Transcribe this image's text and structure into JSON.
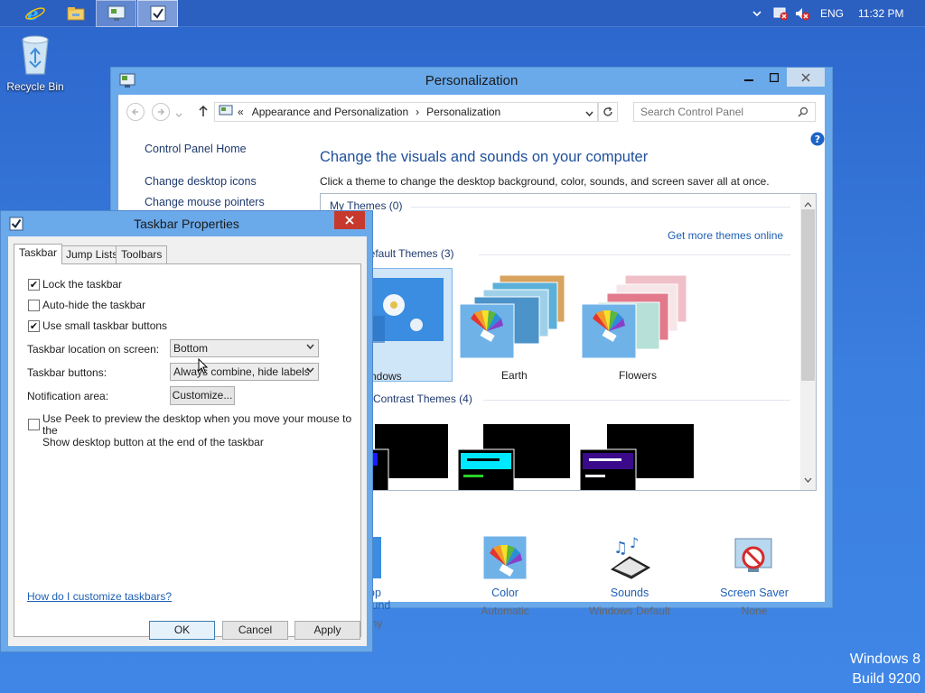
{
  "desktop": {
    "recycle_bin_label": "Recycle Bin",
    "watermark_line1": "Windows 8",
    "watermark_line2": "Build 9200"
  },
  "taskbar": {
    "tray": {
      "language": "ENG",
      "time": "11:32 PM"
    }
  },
  "personalization": {
    "title": "Personalization",
    "breadcrumb": {
      "prefix": "«",
      "parent": "Appearance and Personalization",
      "separator": "›",
      "current": "Personalization"
    },
    "search_placeholder": "Search Control Panel",
    "left_links": {
      "home": "Control Panel Home",
      "desktop_icons": "Change desktop icons",
      "mouse_pointers": "Change mouse pointers"
    },
    "heading": "Change the visuals and sounds on your computer",
    "subtext": "Click a theme to change the desktop background, color, sounds, and screen saver all at once.",
    "themes": {
      "my_themes": "My Themes (0)",
      "get_more": "Get more themes online",
      "default_themes": "Default Themes (3)",
      "default_items": [
        "Windows",
        "Earth",
        "Flowers"
      ],
      "high_contrast": "High Contrast Themes (4)"
    },
    "bottom": [
      {
        "title": "Desktop Background",
        "sub": "Harmony"
      },
      {
        "title": "Color",
        "sub": "Automatic"
      },
      {
        "title": "Sounds",
        "sub": "Windows Default"
      },
      {
        "title": "Screen Saver",
        "sub": "None"
      }
    ]
  },
  "taskbar_properties": {
    "title": "Taskbar Properties",
    "tabs": [
      "Taskbar",
      "Jump Lists",
      "Toolbars"
    ],
    "lock_taskbar": {
      "label": "Lock the taskbar",
      "checked": true
    },
    "auto_hide": {
      "label": "Auto-hide the taskbar",
      "checked": false
    },
    "small_buttons": {
      "label": "Use small taskbar buttons",
      "checked": true
    },
    "location": {
      "label": "Taskbar location on screen:",
      "value": "Bottom"
    },
    "buttons": {
      "label": "Taskbar buttons:",
      "value": "Always combine, hide labels"
    },
    "notification": {
      "label": "Notification area:",
      "button": "Customize..."
    },
    "peek": {
      "line1": "Use Peek to preview the desktop when you move your mouse to the",
      "line2": "Show desktop button at the end of the taskbar",
      "checked": false
    },
    "help_link": "How do I customize taskbars?",
    "ok": "OK",
    "cancel": "Cancel",
    "apply": "Apply"
  },
  "colors": {
    "desktop": "#3b7fe0",
    "window_frame": "#6aa9ea",
    "close_red": "#c7392c",
    "link_blue": "#1e5fb4"
  }
}
